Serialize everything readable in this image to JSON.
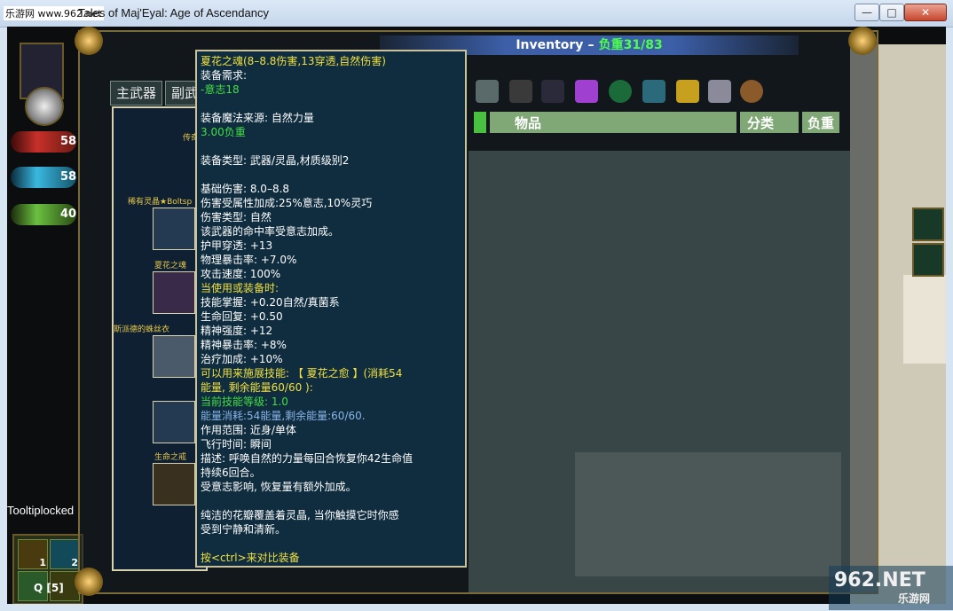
{
  "window": {
    "title": "Tales of Maj'Eyal: Age of Ascendancy",
    "watermark": "乐游网 www.962.net",
    "buttons": [
      "—",
      "□",
      "✕"
    ]
  },
  "inventory": {
    "title": "Inventory",
    "weight_label": "负重31/83",
    "tabs": [
      "主武器",
      "副武"
    ],
    "columns": [
      "物品",
      "分类",
      "负重"
    ]
  },
  "equip_slots": [
    {
      "label": "传奇",
      "name": "legendary-slot"
    },
    {
      "label": "稀有灵晶★Boltsp",
      "name": "rare-crystal-slot"
    },
    {
      "label": "夏花之魂",
      "name": "summer-flower-soul-slot"
    },
    {
      "label": "斯派德的蛛丝衣",
      "name": "spider-silk-robe-slot"
    },
    {
      "label": "",
      "name": "empty-slot"
    },
    {
      "label": "生命之戒",
      "name": "ring-of-life-slot"
    }
  ],
  "left": {
    "resources": [
      {
        "value": "58",
        "color": "#c8302a"
      },
      {
        "value": "58",
        "color": "#3ab8e0"
      },
      {
        "value": "40",
        "color": "#6ac040"
      }
    ],
    "tooltip_locked": "Tooltiplocked",
    "hotkeys": [
      "1",
      "2"
    ],
    "quick_label": "Q [5]"
  },
  "tooltip": {
    "lines": [
      {
        "t": "夏花之魂(8–8.8伤害,13穿透,自然伤害)",
        "c": "c-y"
      },
      {
        "t": "装备需求:",
        "c": "c-w"
      },
      {
        "t": "-意志18",
        "c": "c-g"
      },
      {
        "t": "",
        "c": "gap"
      },
      {
        "t": "装备魔法来源: 自然力量",
        "c": "c-w"
      },
      {
        "t": "3.00负重",
        "c": "c-g"
      },
      {
        "t": "",
        "c": "gap"
      },
      {
        "t": "装备类型: 武器/灵晶,材质级别2",
        "c": "c-w"
      },
      {
        "t": "",
        "c": "gap"
      },
      {
        "t": "基础伤害: 8.0–8.8",
        "c": "c-w"
      },
      {
        "t": "伤害受属性加成:25%意志,10%灵巧",
        "c": "c-w"
      },
      {
        "t": "伤害类型: 自然",
        "c": "c-w"
      },
      {
        "t": "该武器的命中率受意志加成。",
        "c": "c-w"
      },
      {
        "t": "护甲穿透: +13",
        "c": "c-w"
      },
      {
        "t": "物理暴击率: +7.0%",
        "c": "c-w"
      },
      {
        "t": "攻击速度: 100%",
        "c": "c-w"
      },
      {
        "t": "当使用或装备时:",
        "c": "c-y"
      },
      {
        "t": "技能掌握: +0.20自然/真菌系",
        "c": "c-w"
      },
      {
        "t": "生命回复: +0.50",
        "c": "c-w"
      },
      {
        "t": "精神强度: +12",
        "c": "c-w"
      },
      {
        "t": "精神暴击率: +8%",
        "c": "c-w"
      },
      {
        "t": "治疗加成: +10%",
        "c": "c-w"
      },
      {
        "t": "可以用来施展技能: 【 夏花之愈 】(消耗54",
        "c": "c-y"
      },
      {
        "t": "能量, 剩余能量60/60 ):",
        "c": "c-y"
      },
      {
        "t": "当前技能等级: 1.0",
        "c": "c-g"
      },
      {
        "t": "能量消耗:54能量,剩余能量:60/60.",
        "c": "c-b"
      },
      {
        "t": "作用范围: 近身/单体",
        "c": "c-w"
      },
      {
        "t": "飞行时间: 瞬间",
        "c": "c-w"
      },
      {
        "t": "描述: 呼唤自然的力量每回合恢复你42生命值",
        "c": "c-w"
      },
      {
        "t": "持续6回合。",
        "c": "c-w"
      },
      {
        "t": "受意志影响, 恢复量有额外加成。",
        "c": "c-w"
      },
      {
        "t": "",
        "c": "gap"
      },
      {
        "t": "纯洁的花瓣覆盖着灵晶, 当你触摸它时你感",
        "c": "c-w"
      },
      {
        "t": "受到宁静和清新。",
        "c": "c-w"
      },
      {
        "t": "",
        "c": "gap"
      },
      {
        "t": "按<ctrl>来对比装备",
        "c": "c-y"
      }
    ]
  },
  "brand": {
    "big": "962.NET",
    "small": "乐游网"
  },
  "colors": {
    "accent": "#3c5fa8",
    "weight": "#4dff4d",
    "tooltip_bg": "#0f2d3f",
    "header": "#7fa876"
  }
}
